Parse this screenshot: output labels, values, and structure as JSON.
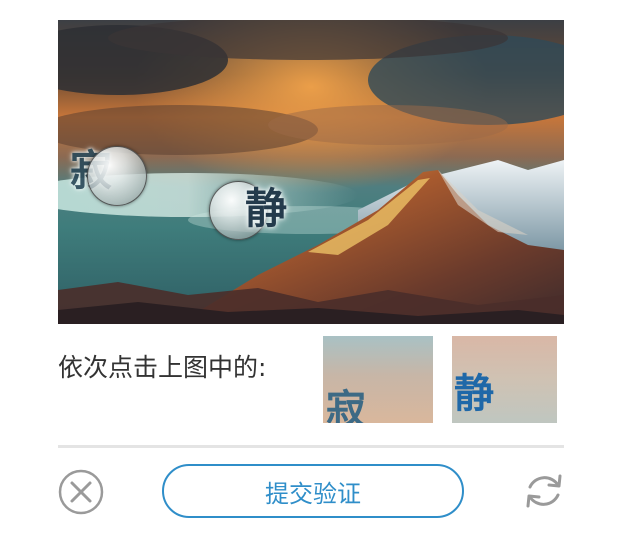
{
  "captcha": {
    "image_description_icon": "mountain-landscape-image",
    "overlay_chars": [
      "寂",
      "静"
    ],
    "instruction": "依次点击上图中的:",
    "hint_chars": [
      "寂",
      "静"
    ]
  },
  "actions": {
    "close_icon": "close-circle-icon",
    "submit_label": "提交验证",
    "refresh_icon": "refresh-icon"
  },
  "colors": {
    "accent": "#2f8ec9",
    "icon_gray": "#9a9a9a",
    "text": "#333333",
    "divider": "#e4e4e4"
  }
}
